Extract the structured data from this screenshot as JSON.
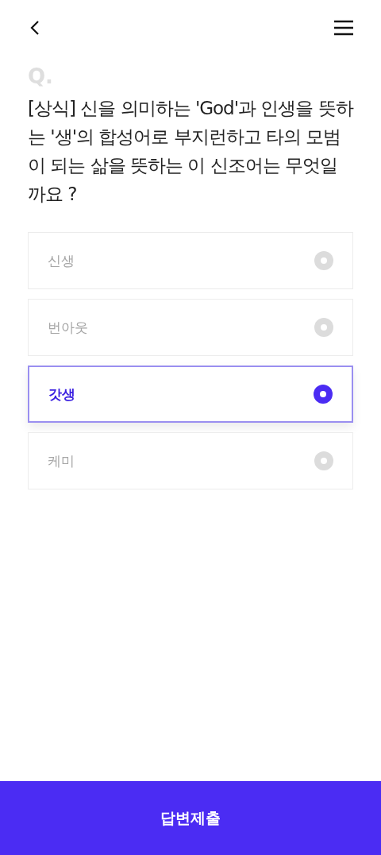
{
  "question": {
    "marker": "Q.",
    "text": "[상식] 신을 의미하는 'God'과 인생을 뜻하는 '생'의 합성어로 부지런하고 타의 모범이 되는 삶을 뜻하는 이 신조어는 무엇일까요 ?"
  },
  "options": [
    {
      "label": "신생",
      "selected": false
    },
    {
      "label": "번아웃",
      "selected": false
    },
    {
      "label": "갓생",
      "selected": true
    },
    {
      "label": "케미",
      "selected": false
    }
  ],
  "submit_button": "답변제출"
}
